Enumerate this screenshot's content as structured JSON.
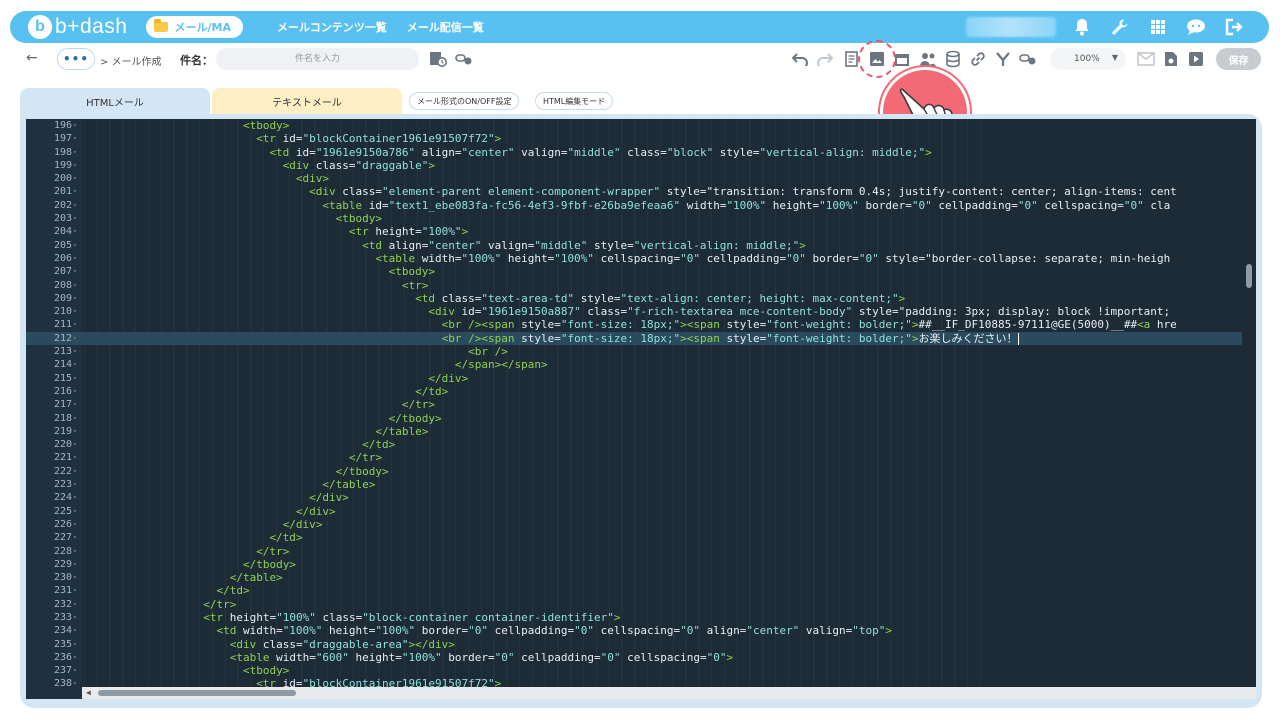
{
  "nav": {
    "logo_text": "b+dash",
    "active_pill": "メール/MA",
    "links": [
      "メールコンテンツ一覧",
      "メール配信一覧"
    ],
    "icons": [
      "bell-icon",
      "wrench-icon",
      "grid-icon",
      "chat-icon",
      "logout-icon"
    ]
  },
  "toolbar": {
    "dots": "•••",
    "breadcrumb": "> メール作成",
    "subject_label": "件名：",
    "subject_placeholder": "件名を入力",
    "zoom": "100%",
    "save_label": "保存"
  },
  "tabs": {
    "html": "HTMLメール",
    "text": "テキストメール",
    "chip_onoff": "メール形式のON/OFF設定",
    "chip_mode": "HTML編集モード"
  },
  "editor": {
    "active_line": 212,
    "lines": [
      {
        "n": "196",
        "t": "                        <tbody>"
      },
      {
        "n": "197",
        "t": "                          <tr id=\"blockContainer1961e91507f72\">"
      },
      {
        "n": "198",
        "t": "                            <td id=\"1961e9150a786\" align=\"center\" valign=\"middle\" class=\"block\" style=\"vertical-align: middle;\">"
      },
      {
        "n": "199",
        "t": "                              <div class=\"draggable\">"
      },
      {
        "n": "200",
        "t": "                                <div>"
      },
      {
        "n": "201",
        "t": "                                  <div class=\"element-parent element-component-wrapper\" style=\"transition: transform 0.4s; justify-content: center; align-items: cent"
      },
      {
        "n": "202",
        "t": "                                    <table id=\"text1_ebe083fa-fc56-4ef3-9fbf-e26ba9efeaa6\" width=\"100%\" height=\"100%\" border=\"0\" cellpadding=\"0\" cellspacing=\"0\" cla"
      },
      {
        "n": "203",
        "t": "                                      <tbody>"
      },
      {
        "n": "204",
        "t": "                                        <tr height=\"100%\">"
      },
      {
        "n": "205",
        "t": "                                          <td align=\"center\" valign=\"middle\" style=\"vertical-align: middle;\">"
      },
      {
        "n": "206",
        "t": "                                            <table width=\"100%\" height=\"100%\" cellspacing=\"0\" cellpadding=\"0\" border=\"0\" style=\"border-collapse: separate; min-heigh"
      },
      {
        "n": "207",
        "t": "                                              <tbody>"
      },
      {
        "n": "208",
        "t": "                                                <tr>"
      },
      {
        "n": "209",
        "t": "                                                  <td class=\"text-area-td\" style=\"text-align: center; height: max-content;\">"
      },
      {
        "n": "210",
        "t": "                                                    <div id=\"1961e9150a887\" class=\"f-rich-textarea mce-content-body\" style=\"padding: 3px; display: block !important;"
      },
      {
        "n": "211",
        "t": "                                                      <br /><span style=\"font-size: 18px;\"><span style=\"font-weight: bolder;\">##__IF_DF10885-97111@GE(5000)__##<a hre"
      },
      {
        "n": "212",
        "t": "                                                      <br /><span style=\"font-size: 18px;\"><span style=\"font-weight: bolder;\">お楽しみください！"
      },
      {
        "n": "213",
        "t": "                                                          <br />"
      },
      {
        "n": "214",
        "t": "                                                        </span></span>"
      },
      {
        "n": "215",
        "t": "                                                    </div>"
      },
      {
        "n": "216",
        "t": "                                                  </td>"
      },
      {
        "n": "217",
        "t": "                                                </tr>"
      },
      {
        "n": "218",
        "t": "                                              </tbody>"
      },
      {
        "n": "219",
        "t": "                                            </table>"
      },
      {
        "n": "220",
        "t": "                                          </td>"
      },
      {
        "n": "221",
        "t": "                                        </tr>"
      },
      {
        "n": "222",
        "t": "                                      </tbody>"
      },
      {
        "n": "223",
        "t": "                                    </table>"
      },
      {
        "n": "224",
        "t": "                                  </div>"
      },
      {
        "n": "225",
        "t": "                                </div>"
      },
      {
        "n": "226",
        "t": "                              </div>"
      },
      {
        "n": "227",
        "t": "                            </td>"
      },
      {
        "n": "228",
        "t": "                          </tr>"
      },
      {
        "n": "229",
        "t": "                        </tbody>"
      },
      {
        "n": "230",
        "t": "                      </table>"
      },
      {
        "n": "231",
        "t": "                    </td>"
      },
      {
        "n": "232",
        "t": "                  </tr>"
      },
      {
        "n": "233",
        "t": "                  <tr height=\"100%\" class=\"block-container container-identifier\">"
      },
      {
        "n": "234",
        "t": "                    <td width=\"100%\" height=\"100%\" border=\"0\" cellpadding=\"0\" cellspacing=\"0\" align=\"center\" valign=\"top\">"
      },
      {
        "n": "235",
        "t": "                      <div class=\"draggable-area\"></div>"
      },
      {
        "n": "236",
        "t": "                      <table width=\"600\" height=\"100%\" border=\"0\" cellpadding=\"0\" cellspacing=\"0\">"
      },
      {
        "n": "237",
        "t": "                        <tbody>"
      },
      {
        "n": "238",
        "t": "                          <tr id=\"blockContainer1961e91507f72\">"
      }
    ]
  },
  "colors": {
    "brand": "#59c1f2",
    "highlight": "#f26a76",
    "editor_bg": "#1d2b37",
    "tag": "#8fd14f",
    "string": "#8ee0d9"
  }
}
